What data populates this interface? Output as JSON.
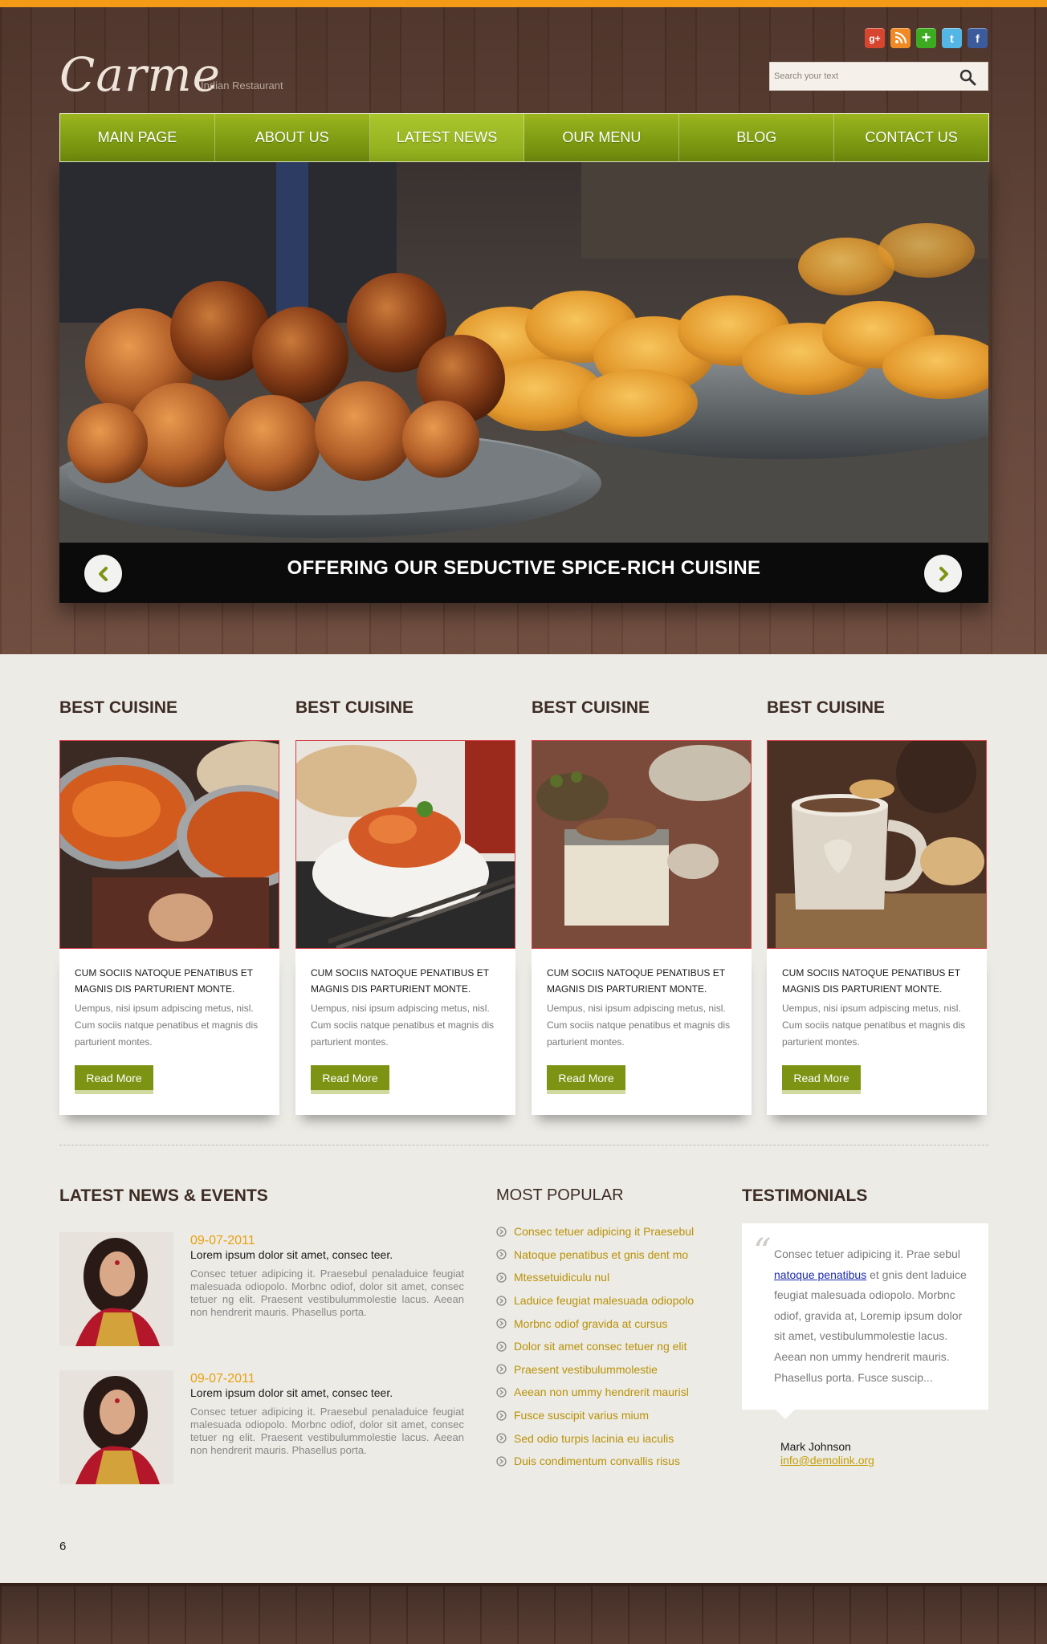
{
  "brand": {
    "logo": "Carme",
    "tagline": "Indian Restaurant"
  },
  "social": [
    {
      "name": "google-plus",
      "glyph": "g+",
      "color": "#d8452f"
    },
    {
      "name": "rss",
      "glyph": "",
      "color": "#f08a24"
    },
    {
      "name": "add",
      "glyph": "+",
      "color": "#3dab21"
    },
    {
      "name": "twitter",
      "glyph": "t",
      "color": "#54b6e4"
    },
    {
      "name": "facebook",
      "glyph": "f",
      "color": "#3b5b9c"
    }
  ],
  "search": {
    "placeholder": "Search your text"
  },
  "nav": {
    "items": [
      "MAIN PAGE",
      "ABOUT US",
      "LATEST NEWS",
      "OUR MENU",
      "BLOG",
      "CONTACT US"
    ],
    "active": "LATEST NEWS"
  },
  "slider": {
    "caption": "OFFERING OUR SEDUCTIVE SPICE-RICH CUISINE"
  },
  "cuisine": [
    {
      "title": "BEST CUISINE",
      "card_title": "CUM SOCIIS NATOQUE PENATIBUS ET MAGNIS DIS PARTURIENT MONTE.",
      "text": "Uempus, nisi ipsum adpiscing metus, nisl. Cum sociis natque penatibus et magnis dis parturient montes.",
      "button": "Read More"
    },
    {
      "title": "BEST CUISINE",
      "card_title": "CUM SOCIIS NATOQUE PENATIBUS ET MAGNIS DIS PARTURIENT MONTE.",
      "text": "Uempus, nisi ipsum adpiscing metus, nisl. Cum sociis natque penatibus et magnis dis parturient montes.",
      "button": "Read More"
    },
    {
      "title": "BEST CUISINE",
      "card_title": "CUM SOCIIS NATOQUE PENATIBUS ET MAGNIS DIS PARTURIENT MONTE.",
      "text": "Uempus, nisi ipsum adpiscing metus, nisl. Cum sociis natque penatibus et magnis dis parturient montes.",
      "button": "Read More"
    },
    {
      "title": "BEST CUISINE",
      "card_title": "CUM SOCIIS NATOQUE PENATIBUS ET MAGNIS DIS PARTURIENT MONTE.",
      "text": "Uempus, nisi ipsum adpiscing metus, nisl. Cum sociis natque penatibus et magnis dis parturient montes.",
      "button": "Read More"
    }
  ],
  "news": {
    "title": "LATEST NEWS & EVENTS",
    "items": [
      {
        "date": "09-07-2011",
        "title": "Lorem ipsum dolor sit amet, consec teer.",
        "text": "Consec tetuer adipicing it. Praesebul penaladuice feugiat malesuada odiopolo. Morbnc odiof, dolor sit amet, consec tetuer ng elit. Praesent vestibulummolestie lacus. Aeean non hendrerit mauris. Phasellus porta."
      },
      {
        "date": "09-07-2011",
        "title": "Lorem ipsum dolor sit amet, consec teer.",
        "text": "Consec tetuer adipicing it. Praesebul penaladuice feugiat malesuada odiopolo. Morbnc odiof, dolor sit amet, consec tetuer ng elit. Praesent vestibulummolestie lacus. Aeean non hendrerit mauris. Phasellus porta."
      }
    ]
  },
  "popular": {
    "title": "MOST POPULAR",
    "items": [
      "Consec tetuer adipicing it Praesebul",
      "Natoque penatibus et gnis dent mo",
      "Mtessetuidiculu nul",
      "Laduice feugiat malesuada odiopolo",
      "Morbnc odiof gravida at cursus",
      "Dolor sit amet consec tetuer ng elit",
      "Praesent vestibulummolestie",
      "Aeean non ummy hendrerit maurisl",
      "Fusce suscipit varius mium",
      "Sed odio turpis lacinia eu iaculis",
      "Duis condimentum convallis risus"
    ]
  },
  "testimonials": {
    "title": "TESTIMONIALS",
    "text_before": "Consec tetuer adipicing it. Prae sebul ",
    "link": "natoque penatibus",
    "text_after": " et gnis dent laduice feugiat malesuada odiopolo. Morbnc odiof, gravida at, Loremip ipsum dolor sit amet, vestibulummolestie lacus. Aeean non ummy hendrerit mauris. Phasellus porta. Fusce suscip...",
    "author": "Mark Johnson",
    "email": "info@demolink.org"
  },
  "page_number": "6",
  "colors": {
    "accent_orange": "#f39a17",
    "nav_green": "#8aa615",
    "button_green": "#7d9313",
    "link_gold": "#b99207",
    "wood_brown": "#5a3d30"
  }
}
